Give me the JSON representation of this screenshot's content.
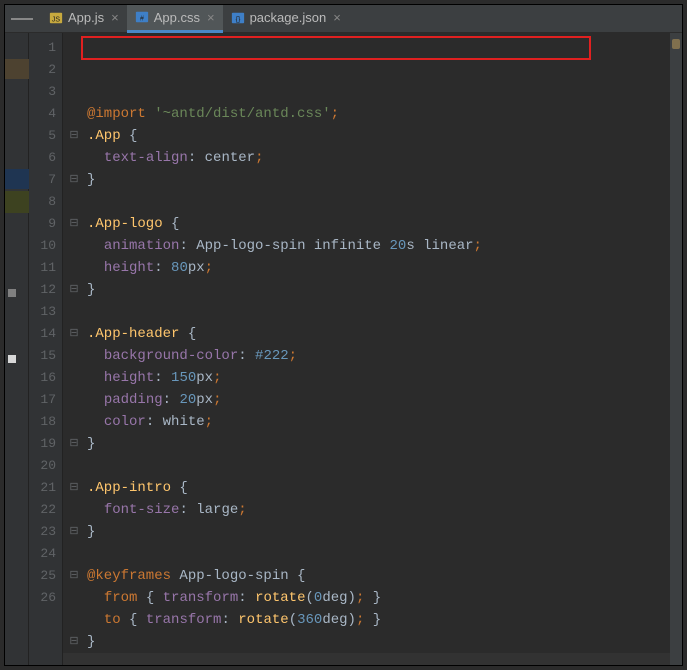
{
  "tabs": {
    "items": [
      {
        "label": "App.js",
        "kind": "js",
        "active": false
      },
      {
        "label": "App.css",
        "kind": "css",
        "active": true
      },
      {
        "label": "package.json",
        "kind": "json",
        "active": false
      }
    ]
  },
  "editor": {
    "highlight_first_line": true,
    "lines": [
      {
        "n": "1",
        "fold": "",
        "tokens": [
          [
            "kw",
            "@import"
          ],
          [
            "white",
            " "
          ],
          [
            "str",
            "'~antd/dist/antd.css'"
          ],
          [
            "semi",
            ";"
          ]
        ]
      },
      {
        "n": "2",
        "fold": "⊟",
        "tokens": [
          [
            "sel",
            ".App"
          ],
          [
            "white",
            " "
          ],
          [
            "brace",
            "{"
          ]
        ]
      },
      {
        "n": "3",
        "fold": "",
        "tokens": [
          [
            "white",
            "  "
          ],
          [
            "prop",
            "text-align"
          ],
          [
            "white",
            ": "
          ],
          [
            "val",
            "center"
          ],
          [
            "semi",
            ";"
          ]
        ]
      },
      {
        "n": "4",
        "fold": "⊟",
        "tokens": [
          [
            "brace",
            "}"
          ]
        ]
      },
      {
        "n": "5",
        "fold": "",
        "tokens": []
      },
      {
        "n": "6",
        "fold": "⊟",
        "tokens": [
          [
            "sel",
            ".App-logo"
          ],
          [
            "white",
            " "
          ],
          [
            "brace",
            "{"
          ]
        ]
      },
      {
        "n": "7",
        "fold": "",
        "tokens": [
          [
            "white",
            "  "
          ],
          [
            "prop",
            "animation"
          ],
          [
            "white",
            ": "
          ],
          [
            "ident",
            "App-logo-spin"
          ],
          [
            "white",
            " "
          ],
          [
            "val",
            "infinite"
          ],
          [
            "white",
            " "
          ],
          [
            "num",
            "20"
          ],
          [
            "val",
            "s"
          ],
          [
            "white",
            " "
          ],
          [
            "val",
            "linear"
          ],
          [
            "semi",
            ";"
          ]
        ]
      },
      {
        "n": "8",
        "fold": "",
        "tokens": [
          [
            "white",
            "  "
          ],
          [
            "prop",
            "height"
          ],
          [
            "white",
            ": "
          ],
          [
            "num",
            "80"
          ],
          [
            "val",
            "px"
          ],
          [
            "semi",
            ";"
          ]
        ]
      },
      {
        "n": "9",
        "fold": "⊟",
        "tokens": [
          [
            "brace",
            "}"
          ]
        ]
      },
      {
        "n": "10",
        "fold": "",
        "tokens": []
      },
      {
        "n": "11",
        "fold": "⊟",
        "tokens": [
          [
            "sel",
            ".App-header"
          ],
          [
            "white",
            " "
          ],
          [
            "brace",
            "{"
          ]
        ]
      },
      {
        "n": "12",
        "fold": "",
        "tokens": [
          [
            "white",
            "  "
          ],
          [
            "prop",
            "background-color"
          ],
          [
            "white",
            ": "
          ],
          [
            "num",
            "#222"
          ],
          [
            "semi",
            ";"
          ]
        ]
      },
      {
        "n": "13",
        "fold": "",
        "tokens": [
          [
            "white",
            "  "
          ],
          [
            "prop",
            "height"
          ],
          [
            "white",
            ": "
          ],
          [
            "num",
            "150"
          ],
          [
            "val",
            "px"
          ],
          [
            "semi",
            ";"
          ]
        ]
      },
      {
        "n": "14",
        "fold": "",
        "tokens": [
          [
            "white",
            "  "
          ],
          [
            "prop",
            "padding"
          ],
          [
            "white",
            ": "
          ],
          [
            "num",
            "20"
          ],
          [
            "val",
            "px"
          ],
          [
            "semi",
            ";"
          ]
        ]
      },
      {
        "n": "15",
        "fold": "",
        "tokens": [
          [
            "white",
            "  "
          ],
          [
            "prop",
            "color"
          ],
          [
            "white",
            ": "
          ],
          [
            "val",
            "white"
          ],
          [
            "semi",
            ";"
          ]
        ]
      },
      {
        "n": "16",
        "fold": "⊟",
        "tokens": [
          [
            "brace",
            "}"
          ]
        ]
      },
      {
        "n": "17",
        "fold": "",
        "tokens": []
      },
      {
        "n": "18",
        "fold": "⊟",
        "tokens": [
          [
            "sel",
            ".App-intro"
          ],
          [
            "white",
            " "
          ],
          [
            "brace",
            "{"
          ]
        ]
      },
      {
        "n": "19",
        "fold": "",
        "tokens": [
          [
            "white",
            "  "
          ],
          [
            "prop",
            "font-size"
          ],
          [
            "white",
            ": "
          ],
          [
            "val",
            "large"
          ],
          [
            "semi",
            ";"
          ]
        ]
      },
      {
        "n": "20",
        "fold": "⊟",
        "tokens": [
          [
            "brace",
            "}"
          ]
        ]
      },
      {
        "n": "21",
        "fold": "",
        "tokens": []
      },
      {
        "n": "22",
        "fold": "⊟",
        "tokens": [
          [
            "kw",
            "@keyframes"
          ],
          [
            "white",
            " "
          ],
          [
            "ident",
            "App-logo-spin"
          ],
          [
            "white",
            " "
          ],
          [
            "brace",
            "{"
          ]
        ]
      },
      {
        "n": "23",
        "fold": "",
        "tokens": [
          [
            "white",
            "  "
          ],
          [
            "kw",
            "from"
          ],
          [
            "white",
            " "
          ],
          [
            "brace",
            "{"
          ],
          [
            "white",
            " "
          ],
          [
            "prop",
            "transform"
          ],
          [
            "white",
            ": "
          ],
          [
            "fn",
            "rotate"
          ],
          [
            "brace",
            "("
          ],
          [
            "num",
            "0"
          ],
          [
            "val",
            "deg"
          ],
          [
            "brace",
            ")"
          ],
          [
            "semi",
            ";"
          ],
          [
            "white",
            " "
          ],
          [
            "brace",
            "}"
          ]
        ]
      },
      {
        "n": "24",
        "fold": "",
        "tokens": [
          [
            "white",
            "  "
          ],
          [
            "kw",
            "to"
          ],
          [
            "white",
            " "
          ],
          [
            "brace",
            "{"
          ],
          [
            "white",
            " "
          ],
          [
            "prop",
            "transform"
          ],
          [
            "white",
            ": "
          ],
          [
            "fn",
            "rotate"
          ],
          [
            "brace",
            "("
          ],
          [
            "num",
            "360"
          ],
          [
            "val",
            "deg"
          ],
          [
            "brace",
            ")"
          ],
          [
            "semi",
            ";"
          ],
          [
            "white",
            " "
          ],
          [
            "brace",
            "}"
          ]
        ]
      },
      {
        "n": "25",
        "fold": "⊟",
        "tokens": [
          [
            "brace",
            "}"
          ]
        ]
      },
      {
        "n": "26",
        "fold": "",
        "tokens": [],
        "caret": true
      }
    ]
  }
}
